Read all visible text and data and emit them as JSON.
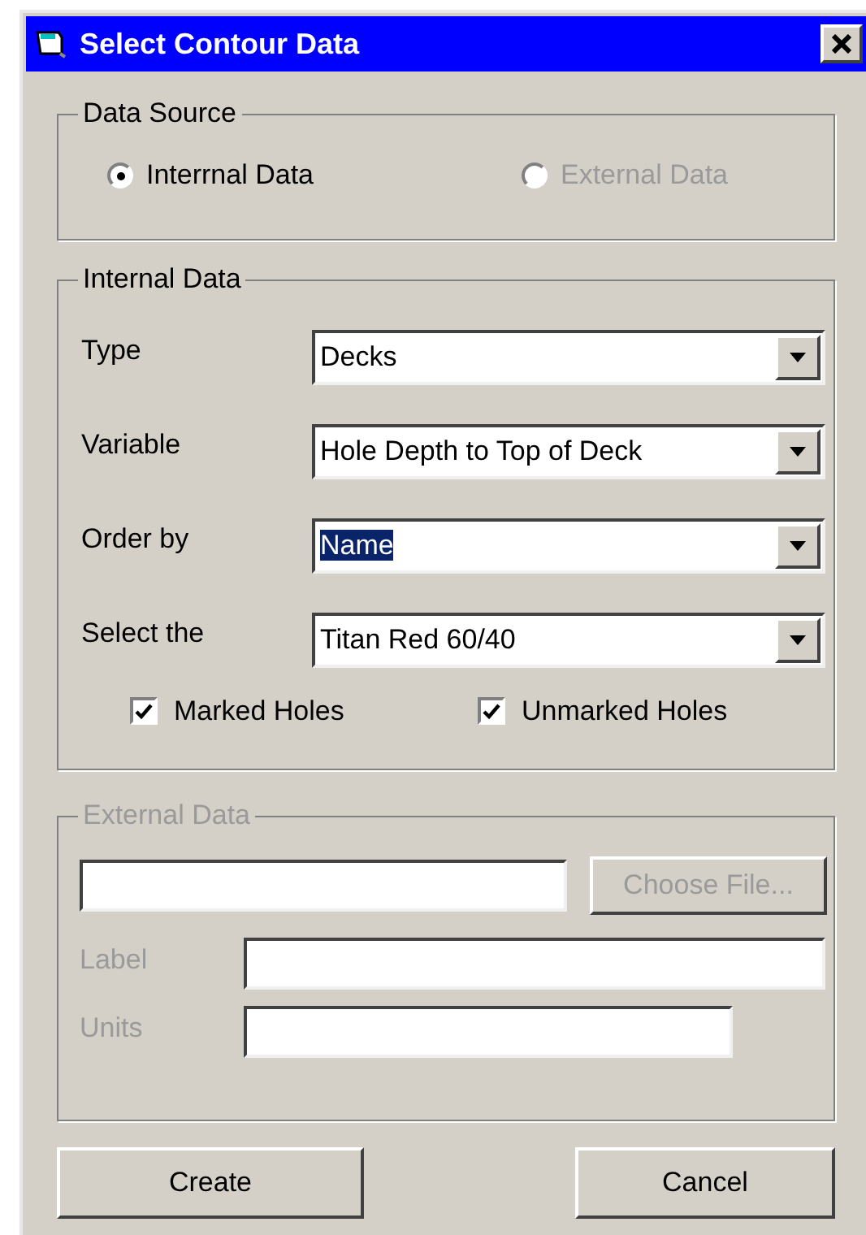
{
  "window": {
    "title": "Select Contour Data"
  },
  "data_source": {
    "legend": "Data Source",
    "options": [
      {
        "label": "Interrnal Data",
        "selected": true,
        "disabled": false
      },
      {
        "label": "External Data",
        "selected": false,
        "disabled": true
      }
    ]
  },
  "internal_data": {
    "legend": "Internal Data",
    "fields": [
      {
        "label": "Type",
        "value": "Decks",
        "highlighted": false
      },
      {
        "label": "Variable",
        "value": "Hole Depth to Top of Deck",
        "highlighted": false
      },
      {
        "label": "Order by",
        "value": "Name",
        "highlighted": true
      },
      {
        "label": "Select the",
        "value": "Titan Red 60/40",
        "highlighted": false
      }
    ],
    "checkboxes": [
      {
        "label": "Marked Holes",
        "checked": true
      },
      {
        "label": "Unmarked Holes",
        "checked": true
      }
    ]
  },
  "external_data": {
    "legend": "External Data",
    "disabled": true,
    "file_button": "Choose File...",
    "fields": [
      {
        "label": "Label"
      },
      {
        "label": "Units"
      }
    ]
  },
  "buttons": [
    "Create",
    "Cancel"
  ]
}
